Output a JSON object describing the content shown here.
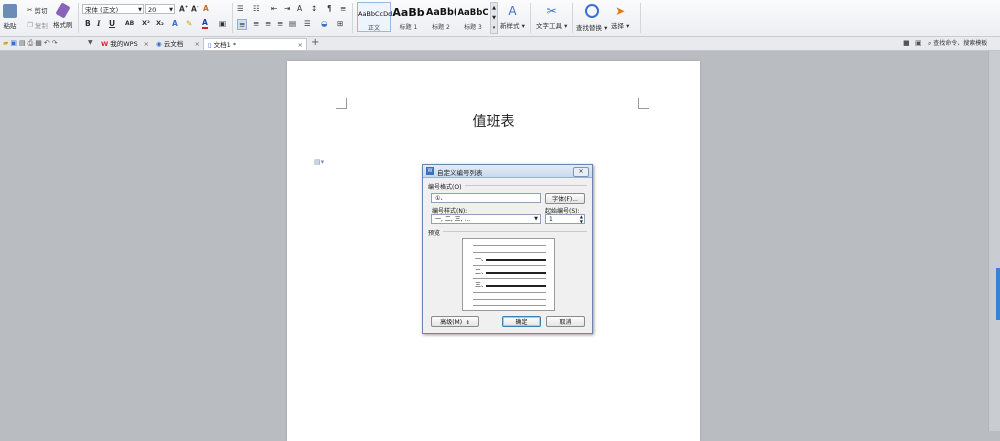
{
  "ribbon": {
    "paste": "粘贴",
    "cut": "剪切",
    "copy": "复制",
    "format_painter": "格式刷",
    "font_name": "宋体 (正文)",
    "font_size": "20",
    "bold": "B",
    "italic": "I",
    "underline": "U",
    "strike": "AB",
    "superscript": "X²",
    "subscript": "X₂",
    "styles": [
      {
        "sample": "AaBbCcDd",
        "label": "正文"
      },
      {
        "sample": "AaBb",
        "label": "标题 1"
      },
      {
        "sample": "AaBb(",
        "label": "标题 2"
      },
      {
        "sample": "AaBbC",
        "label": "标题 3"
      }
    ],
    "new_style": "新样式",
    "text_tools": "文字工具",
    "find_replace": "查找替换",
    "select": "选择"
  },
  "tabs": [
    {
      "label": "我的WPS"
    },
    {
      "label": "云文档"
    },
    {
      "label": "文档1 *"
    }
  ],
  "search_placeholder": "查找命令、搜索模板",
  "document": {
    "title": "值班表"
  },
  "dialog": {
    "title": "自定义编号列表",
    "format_group": "编号格式(O)",
    "format_value": "①、",
    "font_button": "字体(F)...",
    "style_label": "编号样式(N):",
    "style_value": "一, 二, 三, ...",
    "start_label": "起始编号(S):",
    "start_value": "1",
    "preview_group": "预览",
    "preview_items": [
      "一、",
      "二、",
      "三、"
    ],
    "advanced_button": "高级(M)",
    "ok_button": "确定",
    "cancel_button": "取消"
  }
}
